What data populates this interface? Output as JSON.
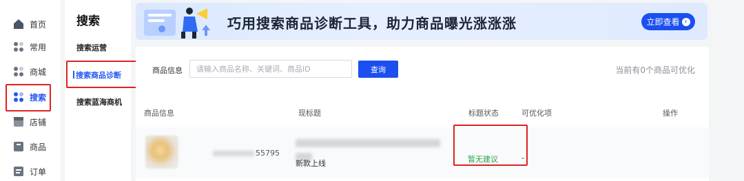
{
  "rail": {
    "items": [
      {
        "label": "首页",
        "icon": "home-icon"
      },
      {
        "label": "常用",
        "icon": "grid-icon"
      },
      {
        "label": "商城",
        "icon": "grid-icon"
      },
      {
        "label": "搜索",
        "icon": "grid-icon",
        "active": true
      },
      {
        "label": "店铺",
        "icon": "store-icon"
      },
      {
        "label": "商品",
        "icon": "box-icon"
      },
      {
        "label": "订单",
        "icon": "order-icon"
      }
    ]
  },
  "submenu": {
    "title": "搜索",
    "items": [
      {
        "label": "搜索运营"
      },
      {
        "label": "搜索商品诊断",
        "active": true
      },
      {
        "label": "搜索蓝海商机"
      }
    ]
  },
  "banner": {
    "text": "巧用搜索商品诊断工具，助力商品曝光涨涨涨",
    "button_label": "立即查看"
  },
  "filter": {
    "label": "商品信息",
    "placeholder": "请输入商品名称、关键词、商品ID",
    "query_label": "查询",
    "optimize_count": "当前有0个商品可优化"
  },
  "table": {
    "headers": [
      "商品信息",
      "现标题",
      "标题状态",
      "可优化项",
      "操作"
    ],
    "rows": [
      {
        "id_visible": "55795",
        "title_visible": "新款上线",
        "status": "暂无建议",
        "optimize": "-"
      }
    ]
  },
  "colors": {
    "accent": "#1b4ff0",
    "status_green": "#22a34a",
    "highlight_red": "#e02020"
  }
}
